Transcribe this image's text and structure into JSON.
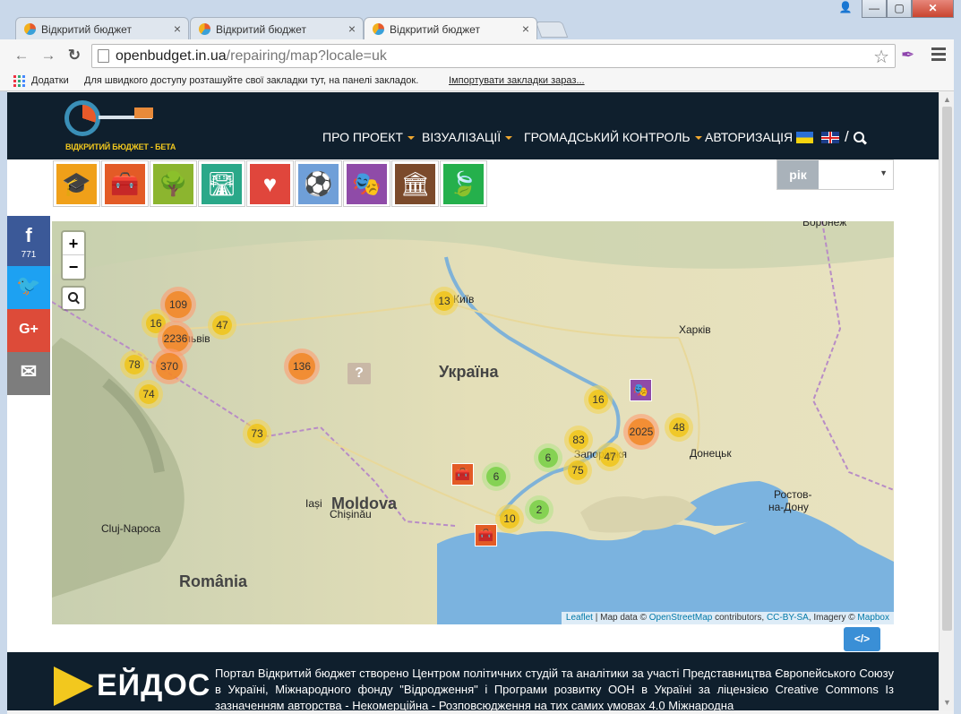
{
  "browser": {
    "tabs": [
      {
        "title": "Відкритий бюджет",
        "close": "×"
      },
      {
        "title": "Відкритий бюджет",
        "close": "×"
      },
      {
        "title": "Відкритий бюджет",
        "close": "×"
      }
    ],
    "window_buttons": {
      "minimize": "—",
      "maximize": "▢",
      "close": "✕"
    },
    "url_host": "openbudget.in.ua",
    "url_path": "/repairing/map?locale=uk",
    "bookmarks_label": "Додатки",
    "bookmarks_hint": "Для швидкого доступу розташуйте свої закладки тут, на панелі закладок.",
    "bookmarks_import": "Імпортувати закладки зараз..."
  },
  "site": {
    "logo_text": "ВІДКРИТИЙ БЮДЖЕТ - БЕТА",
    "nav": [
      "ПРО ПРОЕКТ",
      "ВІЗУАЛІЗАЦІЇ",
      "ГРОМАДСЬКИЙ КОНТРОЛЬ",
      "АВТОРИЗАЦІЯ"
    ],
    "slash": "/",
    "year_label": "рік",
    "categories": [
      {
        "icon": "graduation-cap-icon",
        "color": "#f0a019",
        "glyph": "🎓"
      },
      {
        "icon": "toolbox-icon",
        "color": "#e35b26",
        "glyph": "🧰"
      },
      {
        "icon": "park-tree-icon",
        "color": "#8cb52f",
        "glyph": "🌳"
      },
      {
        "icon": "road-icon",
        "color": "#2aa889",
        "glyph": "🛣"
      },
      {
        "icon": "heart-pulse-icon",
        "color": "#e0463c",
        "glyph": "♥"
      },
      {
        "icon": "football-icon",
        "color": "#6f9fd8",
        "glyph": "⚽"
      },
      {
        "icon": "theatre-masks-icon",
        "color": "#8f4ba8",
        "glyph": "🎭"
      },
      {
        "icon": "museum-columns-icon",
        "color": "#7b4a2b",
        "glyph": "🏛"
      },
      {
        "icon": "leaves-icon",
        "color": "#25b04c",
        "glyph": "🍃"
      }
    ],
    "embed_label": "</>",
    "share": {
      "fb_icon": "f",
      "fb_count": "771",
      "tw_icon": "🐦",
      "gp_icon": "G+",
      "em_icon": "✉"
    },
    "footer_logo": "ЕЙДОС",
    "footer_text": "Портал Відкритий бюджет створено Центром політичних студій та аналітики за участі Представництва Європейського Союзу в Україні, Міжнародного фонду \"Відродження\" і Програми розвитку ООН в Україні за ліцензією Creative Commons Із зазначенням авторства - Некомерційна - Розповсюдження на тих самих умовах 4.0 Міжнародна"
  },
  "map": {
    "zoom_in": "+",
    "zoom_out": "−",
    "labels": [
      {
        "text": "Україна",
        "kind": "country"
      },
      {
        "text": "Moldova",
        "kind": "country"
      },
      {
        "text": "România",
        "kind": "country"
      },
      {
        "text": "Київ",
        "kind": "city"
      },
      {
        "text": "Харків",
        "kind": "city"
      },
      {
        "text": "Донецьк",
        "kind": "city"
      },
      {
        "text": "Воронеж",
        "kind": "city"
      },
      {
        "text": "Ростов-",
        "kind": "city"
      },
      {
        "text": "на-Дону",
        "kind": "city"
      },
      {
        "text": "Iași",
        "kind": "city"
      },
      {
        "text": "Chișinău",
        "kind": "city"
      },
      {
        "text": "Cluj-Napoca",
        "kind": "city"
      },
      {
        "text": "Запоріжжя",
        "kind": "city"
      },
      {
        "text": "львів",
        "kind": "city"
      }
    ],
    "clusters": [
      {
        "count": "109",
        "color": "orange"
      },
      {
        "count": "16",
        "color": "yellow"
      },
      {
        "count": "47",
        "color": "yellow"
      },
      {
        "count": "2236",
        "color": "orange"
      },
      {
        "count": "78",
        "color": "yellow"
      },
      {
        "count": "370",
        "color": "orange"
      },
      {
        "count": "74",
        "color": "yellow"
      },
      {
        "count": "136",
        "color": "orange"
      },
      {
        "count": "13",
        "color": "yellow"
      },
      {
        "count": "73",
        "color": "yellow"
      },
      {
        "count": "16",
        "color": "yellow"
      },
      {
        "count": "2025",
        "color": "orange"
      },
      {
        "count": "48",
        "color": "yellow"
      },
      {
        "count": "83",
        "color": "yellow"
      },
      {
        "count": "6",
        "color": "green"
      },
      {
        "count": "47",
        "color": "yellow"
      },
      {
        "count": "75",
        "color": "yellow"
      },
      {
        "count": "6",
        "color": "green"
      },
      {
        "count": "2",
        "color": "green"
      },
      {
        "count": "10",
        "color": "yellow"
      }
    ],
    "unknown_marker": "?",
    "attribution": {
      "leaflet": "Leaflet",
      "sep1": " | Map data © ",
      "osm": "OpenStreetMap",
      "contrib": " contributors, ",
      "license": "CC-BY-SA",
      "imagery": ", Imagery © ",
      "mapbox": "Mapbox"
    }
  }
}
